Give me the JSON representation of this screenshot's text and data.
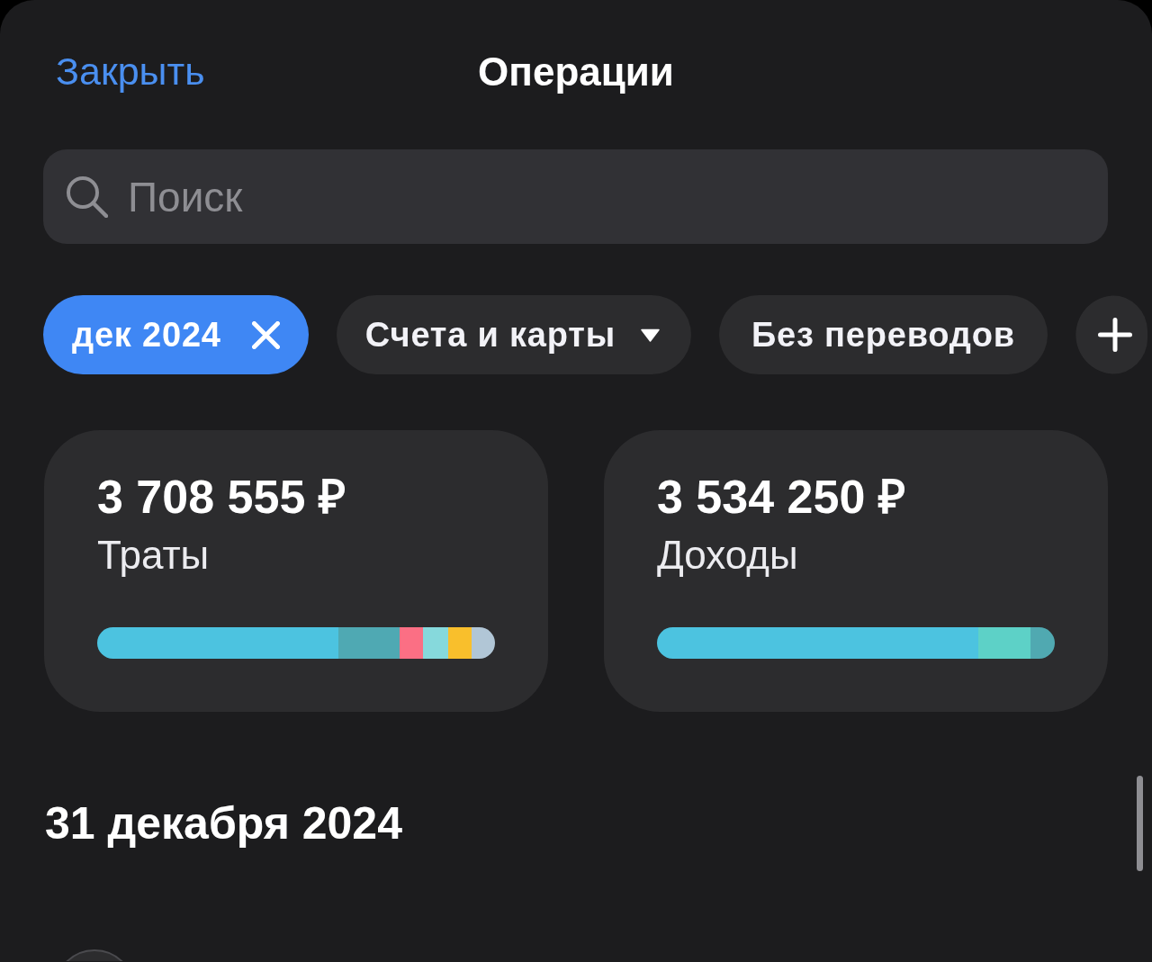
{
  "nav": {
    "close": "Закрыть",
    "title": "Операции"
  },
  "search": {
    "placeholder": "Поиск"
  },
  "filters": [
    {
      "kind": "removable",
      "label": "дек 2024",
      "selected": true
    },
    {
      "kind": "dropdown",
      "label": "Счета и карты",
      "selected": false
    },
    {
      "kind": "toggle",
      "label": "Без переводов",
      "selected": false
    },
    {
      "kind": "add",
      "selected": false
    }
  ],
  "summary": [
    {
      "amount": "3 708 555 ₽",
      "label": "Траты",
      "segments": [
        {
          "color": "#4cc3e0"
        },
        {
          "color": "#4fa9b3"
        },
        {
          "color": "#fb6f84"
        },
        {
          "color": "#86d9dc"
        },
        {
          "color": "#f9bf2c"
        },
        {
          "color": "#b1c6d6"
        }
      ]
    },
    {
      "amount": "3 534 250 ₽",
      "label": "Доходы",
      "segments": [
        {
          "color": "#4cc3e0"
        },
        {
          "color": "#5dd1c7"
        },
        {
          "color": "#50a9b1"
        }
      ]
    }
  ],
  "sections": [
    {
      "date": "31 декабря 2024"
    }
  ]
}
